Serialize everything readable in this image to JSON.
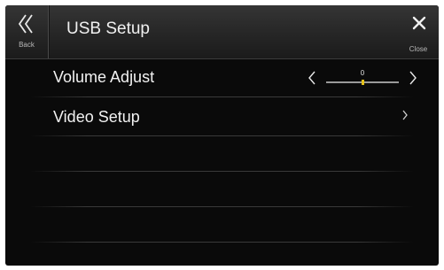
{
  "header": {
    "back_label": "Back",
    "title": "USB Setup",
    "close_label": "Close"
  },
  "settings": [
    {
      "label": "Volume Adjust",
      "control": "slider",
      "value": "0",
      "slider_position_fraction": 0.5
    },
    {
      "label": "Video Setup",
      "control": "submenu"
    }
  ],
  "colors": {
    "background": "#0a0a0a",
    "header": "#2a2a2a",
    "text": "#f2f2f2",
    "slider_thumb": "#e6c21a"
  },
  "icons": {
    "back": "double-chevron-left-icon",
    "close": "close-x-icon",
    "decrease": "chevron-left-icon",
    "increase": "chevron-right-icon",
    "submenu": "chevron-right-icon"
  }
}
